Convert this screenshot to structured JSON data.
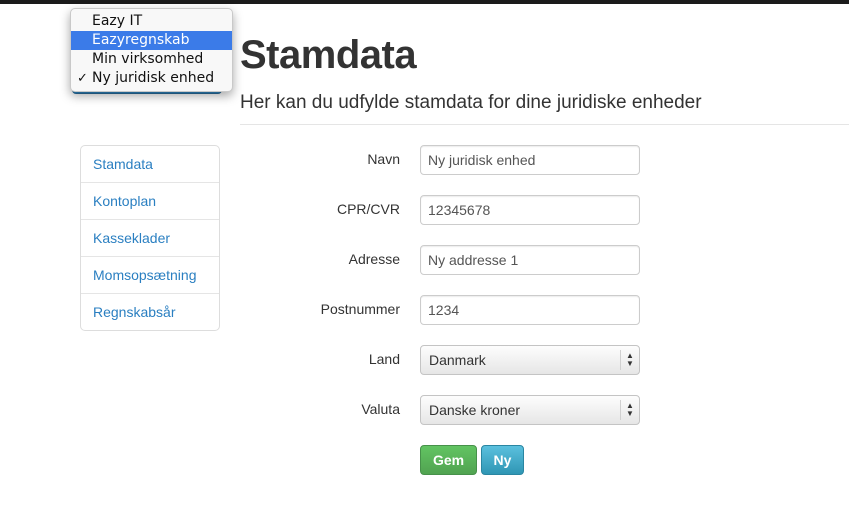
{
  "entity_dropdown": {
    "options": [
      {
        "label": "Eazy IT",
        "highlighted": false,
        "checked": false
      },
      {
        "label": "Eazyregnskab",
        "highlighted": true,
        "checked": false
      },
      {
        "label": "Min virksomhed",
        "highlighted": false,
        "checked": false
      },
      {
        "label": "Ny juridisk enhed",
        "highlighted": false,
        "checked": true
      }
    ],
    "check_glyph": "✓"
  },
  "header": {
    "title": "Stamdata",
    "subtitle": "Her kan du udfylde stamdata for dine juridiske enheder"
  },
  "sidebar": {
    "items": [
      {
        "label": "Stamdata"
      },
      {
        "label": "Kontoplan"
      },
      {
        "label": "Kasseklader"
      },
      {
        "label": "Momsopsætning"
      },
      {
        "label": "Regnskabsår"
      }
    ]
  },
  "form": {
    "name": {
      "label": "Navn",
      "value": "Ny juridisk enhed"
    },
    "cpr_cvr": {
      "label": "CPR/CVR",
      "value": "12345678"
    },
    "address": {
      "label": "Adresse",
      "value": "Ny addresse 1"
    },
    "postal": {
      "label": "Postnummer",
      "value": "1234"
    },
    "country": {
      "label": "Land",
      "selected": "Danmark"
    },
    "currency": {
      "label": "Valuta",
      "selected": "Danske kroner"
    }
  },
  "buttons": {
    "save_label": "Gem",
    "new_label": "Ny"
  },
  "colors": {
    "link": "#2a7fc1",
    "save_button": "#5bb75b",
    "new_button": "#49afcd",
    "dropdown_highlight": "#3b7be8"
  }
}
